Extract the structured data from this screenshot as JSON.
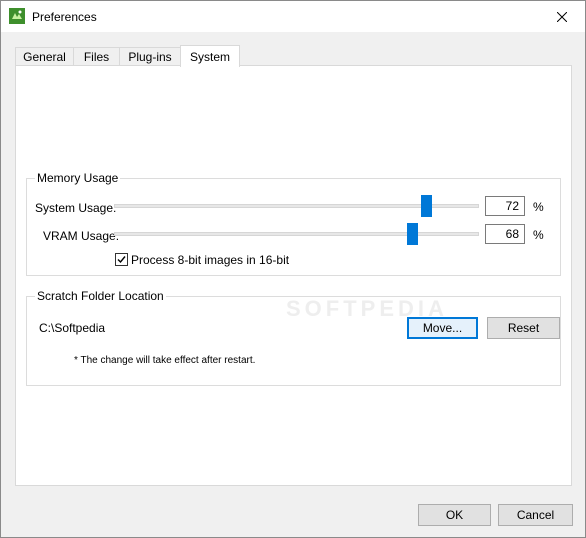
{
  "window": {
    "title": "Preferences"
  },
  "tabs": [
    {
      "label": "General"
    },
    {
      "label": "Files"
    },
    {
      "label": "Plug-ins"
    },
    {
      "label": "System",
      "selected": true
    }
  ],
  "memory_usage": {
    "group_label": "Memory Usage",
    "system_usage": {
      "label": "System Usage:",
      "value": "72",
      "unit": "%"
    },
    "vram_usage": {
      "label": "VRAM Usage:",
      "value": "68",
      "unit": "%"
    },
    "process_8bit": {
      "label": "Process 8-bit images in 16-bit",
      "checked": true
    }
  },
  "scratch_folder": {
    "group_label": "Scratch Folder Location",
    "path": "C:\\Softpedia",
    "move_label": "Move...",
    "reset_label": "Reset",
    "note": "* The change will take effect after restart."
  },
  "footer": {
    "ok_label": "OK",
    "cancel_label": "Cancel"
  },
  "watermark": "SOFTPEDIA",
  "colors": {
    "accent": "#0078d7",
    "app_icon": "#3e8f2c"
  },
  "icons": {
    "app": "app-icon",
    "close": "close-icon",
    "check": "checkmark-icon"
  }
}
